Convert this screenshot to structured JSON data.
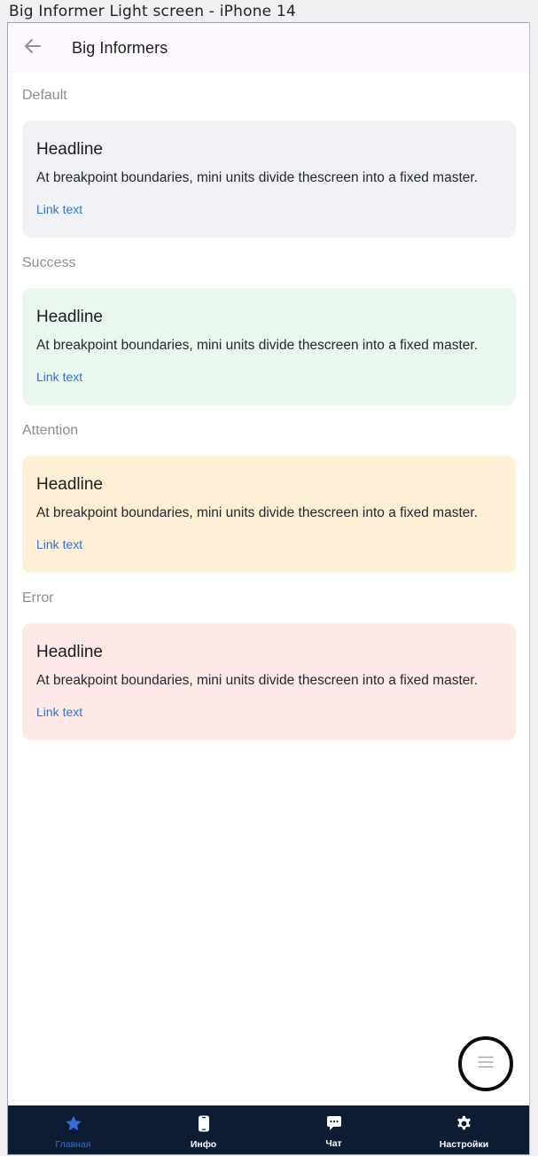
{
  "frame_label": "Big Informer Light screen - iPhone 14",
  "appbar": {
    "title": "Big Informers",
    "back_icon": "arrow-left-icon"
  },
  "sections": [
    {
      "label": "Default",
      "bg": "#f1f2f5",
      "card": {
        "headline": "Headline",
        "body": "At breakpoint boundaries, mini units divide thescreen into a fixed master.",
        "link": "Link text"
      }
    },
    {
      "label": "Success",
      "bg": "#eaf7ef",
      "card": {
        "headline": "Headline",
        "body": "At breakpoint boundaries, mini units divide thescreen into a fixed master.",
        "link": "Link text"
      }
    },
    {
      "label": "Attention",
      "bg": "#fdefd6",
      "card": {
        "headline": "Headline",
        "body": "At breakpoint boundaries, mini units divide thescreen into a fixed master.",
        "link": "Link text"
      }
    },
    {
      "label": "Error",
      "bg": "#fde9e8",
      "card": {
        "headline": "Headline",
        "body": "At breakpoint boundaries, mini units divide thescreen into a fixed master.",
        "link": "Link text"
      }
    }
  ],
  "fab": {
    "icon": "menu-lines-icon"
  },
  "tabbar": {
    "items": [
      {
        "label": "Главная",
        "icon": "star-icon",
        "active": true
      },
      {
        "label": "Инфо",
        "icon": "phone-icon",
        "active": false
      },
      {
        "label": "Чат",
        "icon": "chat-bubble-icon",
        "active": false
      },
      {
        "label": "Настройки",
        "icon": "gear-icon",
        "active": false
      }
    ]
  },
  "colors": {
    "accent": "#2f73d9",
    "tabbar_bg": "#0d1b33",
    "appbar_bg": "#fdf8fd"
  }
}
